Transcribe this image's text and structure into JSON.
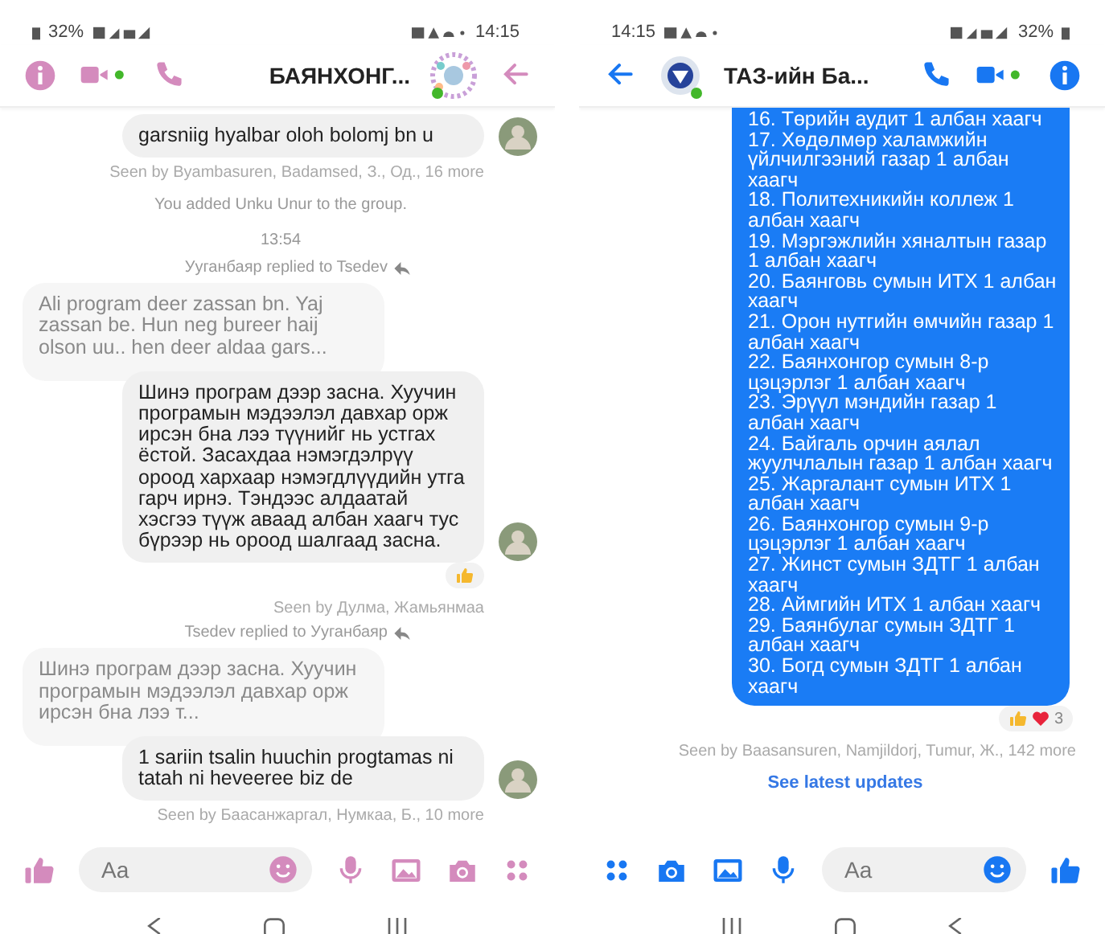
{
  "phones": [
    {
      "mirrored": true,
      "color": "#d48bbd",
      "status": {
        "time": "14:15",
        "battery": "32%"
      },
      "header": {
        "title": "БАЯНХОНГ..."
      },
      "messages": [
        {
          "kind": "received",
          "text": "garsniig hyalbar oloh bolomj bn u",
          "avatar": true
        },
        {
          "kind": "seen",
          "text": "Seen by Byambasuren, Badamsed, З., Од., 16 more"
        },
        {
          "kind": "system",
          "text": "You added Unku Unur to the group."
        },
        {
          "kind": "time",
          "text": "13:54"
        },
        {
          "kind": "reply_note",
          "text": "Ууганбаяр replied to Tsedev"
        },
        {
          "kind": "quote",
          "text": "Ali program deer zassan bn. Yaj zassan be. Hun neg bureer haij olson uu.. hen deer aldaa gars..."
        },
        {
          "kind": "received",
          "text": "Шинэ програм дээр засна. Хуучин програмын мэдээлэл давхар орж ирсэн бна лээ түүнийг нь устгах ёстой. Засахдаа нэмэгдэлрүү ороод хархаар нэмэгдлүүдийн утга гарч ирнэ. Тэндээс алдаатай хэсгээ түүж аваад албан хаагч тус бүрээр нь ороод шалгаад засна.",
          "avatar": true
        },
        {
          "kind": "reactions",
          "reactions": [
            {
              "kind": "like"
            }
          ]
        },
        {
          "kind": "seen",
          "text": "Seen by Дулма, Жамьянмаа"
        },
        {
          "kind": "reply_note",
          "text": "Tsedev replied to Ууганбаяр"
        },
        {
          "kind": "quote",
          "text": "Шинэ програм дээр засна. Хуучин програмын мэдээлэл давхар орж ирсэн бна лээ т..."
        },
        {
          "kind": "received",
          "text": "1 sariin tsalin huuchin progtamas ni tatah ni heveeree biz de",
          "avatar": true
        },
        {
          "kind": "seen",
          "text": "Seen by Баасанжаргал, Нумкаа, Б., 10 more"
        }
      ],
      "composer": {
        "placeholder": "Aa"
      }
    },
    {
      "mirrored": false,
      "color": "#1877f2",
      "status": {
        "time": "14:15",
        "battery": "32%"
      },
      "header": {
        "title": "ТАЗ-ийн Ба..."
      },
      "messages": [
        {
          "kind": "sent",
          "text": "16. Төрийн аудит 1 албан хаагч\n17. Хөдөлмөр халамжийн үйлчилгээний газар 1 албан хаагч\n18. Политехникийн коллеж 1 албан хаагч\n19. Мэргэжлийн хяналтын газар 1 албан хаагч\n20. Баянговь сумын ИТХ 1 албан хаагч\n21. Орон нутгийн өмчийн газар 1 албан хаагч\n22. Баянхонгор сумын 8-р цэцэрлэг 1 албан хаагч\n23. Эрүүл мэндийн газар 1 албан хаагч\n24. Байгаль орчин аялал жуулчлалын газар 1 албан хаагч\n25. Жаргалант сумын ИТХ 1 албан хаагч\n26. Баянхонгор сумын 9-р цэцэрлэг 1 албан хаагч\n27. Жинст сумын ЗДТГ 1 албан хаагч\n28. Аймгийн ИТХ 1 албан хаагч\n29. Баянбулаг сумын ЗДТГ 1 албан хаагч\n30. Богд сумын ЗДТГ 1 албан хаагч"
        },
        {
          "kind": "reactions",
          "reactions": [
            {
              "kind": "like"
            },
            {
              "kind": "love"
            }
          ],
          "count": "3"
        },
        {
          "kind": "seen",
          "text": "Seen by Baasansuren, Namjildorj, Tumur, Ж., 142 more"
        },
        {
          "kind": "link",
          "text": "See latest updates"
        }
      ],
      "composer": {
        "placeholder": "Aa"
      }
    }
  ]
}
